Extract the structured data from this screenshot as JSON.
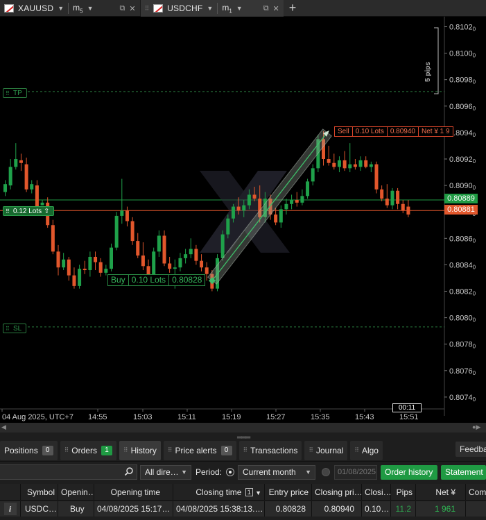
{
  "tabs": [
    {
      "symbol": "XAUUSD",
      "timeframe": "m",
      "timeframe_sub": "5",
      "active": false
    },
    {
      "symbol": "USDCHF",
      "timeframe": "m",
      "timeframe_sub": "1",
      "active": true
    }
  ],
  "chart": {
    "price_labels": [
      "0.8102",
      "0.8100",
      "0.8098",
      "0.8096",
      "0.8094",
      "0.8092",
      "0.8090",
      "0.8088",
      "0.8086",
      "0.8084",
      "0.8082",
      "0.8080",
      "0.8078",
      "0.8076",
      "0.8074"
    ],
    "price_label_suffix": "0",
    "time_labels": [
      "04 Aug 2025, UTC+7",
      "14:55",
      "15:03",
      "15:11",
      "15:19",
      "15:27",
      "15:35",
      "15:43",
      "15:51"
    ],
    "pips_label": "5 pips",
    "tp_label": "TP",
    "sl_label": "SL",
    "position_lots_label": "0.12 Lots",
    "current_bid": "0.80889",
    "current_ask": "0.80881",
    "sell_order": {
      "side": "Sell",
      "lots": "0.10 Lots",
      "price": "0.80940",
      "net": "Net ¥ 1 9"
    },
    "buy_order": {
      "side": "Buy",
      "lots": "0.10 Lots",
      "price": "0.80828"
    },
    "timer": "00:11",
    "colors": {
      "bull": "#1fa14a",
      "bear": "#e2572c",
      "tp_sl_line": "#2a7a3e"
    }
  },
  "panel": {
    "tabs": [
      {
        "label": "Positions",
        "count": "0"
      },
      {
        "label": "Orders",
        "count": "1"
      },
      {
        "label": "History"
      },
      {
        "label": "Price alerts",
        "count": "0"
      },
      {
        "label": "Transactions"
      },
      {
        "label": "Journal"
      },
      {
        "label": "Algo"
      }
    ],
    "feedback_label": "Feedba",
    "filters": {
      "direction": "All dire…",
      "period_label": "Period:",
      "period_value": "Current month",
      "date_value": "01/08/2025",
      "order_history_label": "Order history",
      "statement_label": "Statement"
    },
    "columns": [
      "Symbol",
      "Openin…",
      "Opening time",
      "Closing time",
      "1",
      "Entry price",
      "Closing pri…",
      "Closi…",
      "Pips",
      "Net ¥",
      "Com"
    ],
    "rows": [
      {
        "info": "i",
        "symbol": "USDC…",
        "opening": "Buy",
        "opening_time": "04/08/2025 15:17…",
        "closing_time": "04/08/2025 15:38:13.…",
        "entry_price": "0.80828",
        "closing_price": "0.80940",
        "closing_volume": "0.10…",
        "pips": "11.2",
        "net": "1 961"
      }
    ]
  }
}
